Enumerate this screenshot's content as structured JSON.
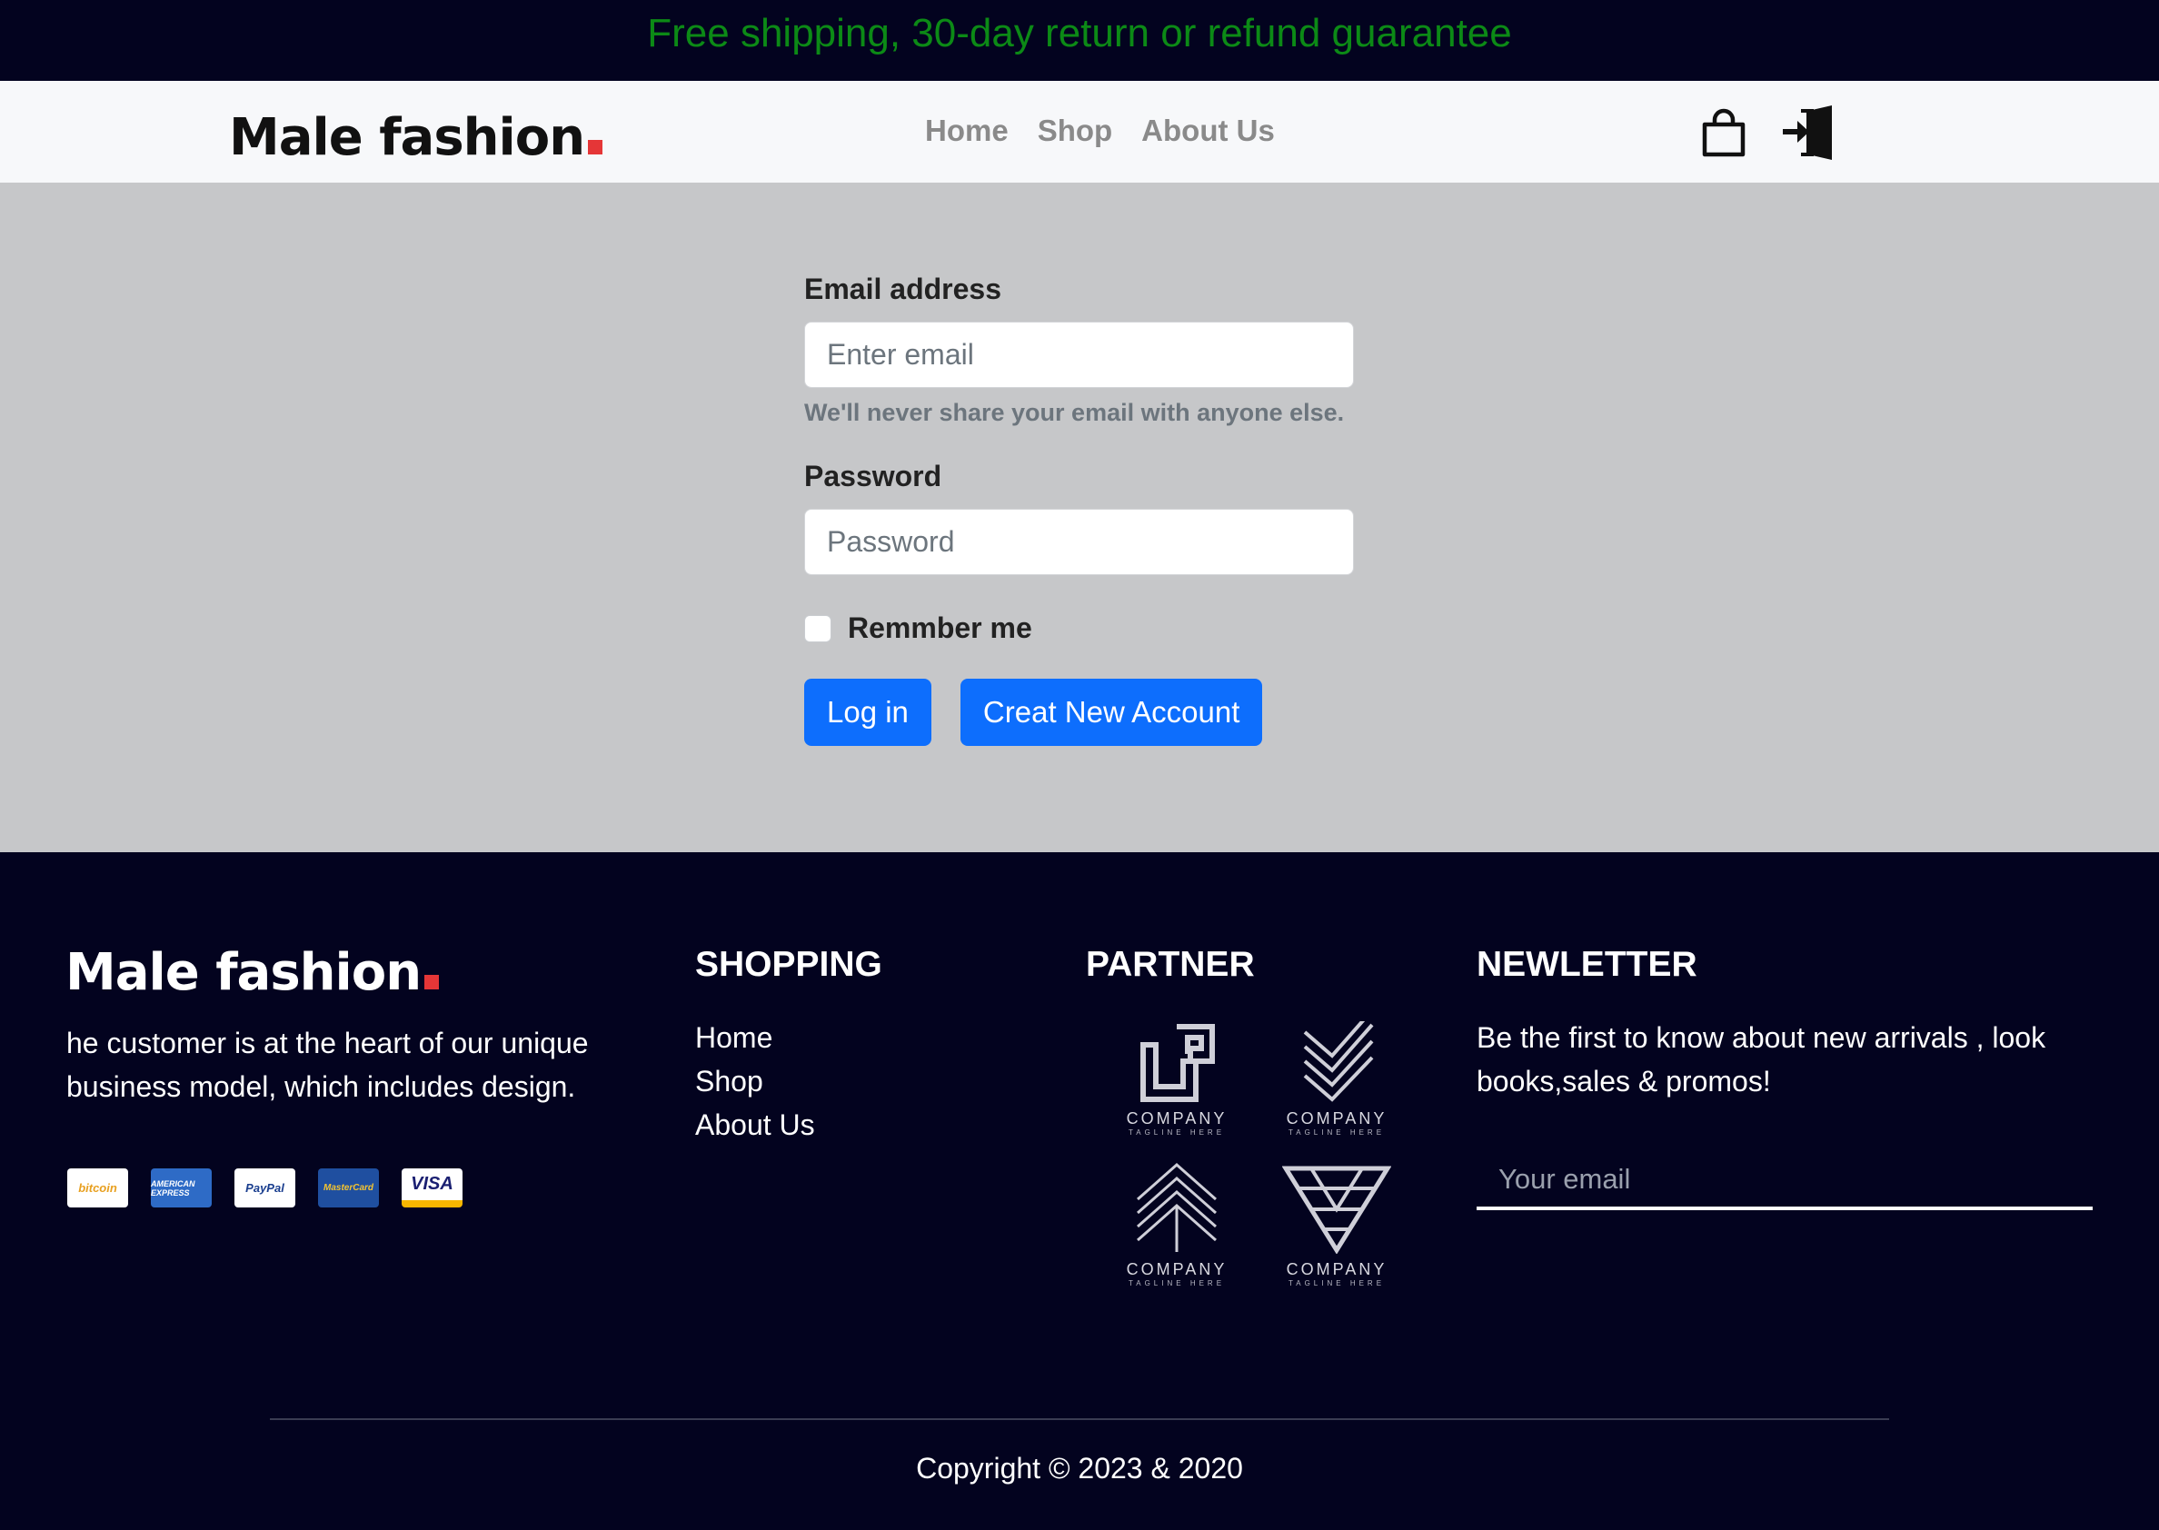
{
  "promo": {
    "text": "Free shipping, 30-day return or refund guarantee"
  },
  "brand": {
    "name": "Male fashion"
  },
  "nav": {
    "links": [
      "Home",
      "Shop",
      "About Us"
    ],
    "icons": [
      "shopping-bag-icon",
      "sign-in-icon"
    ]
  },
  "login": {
    "email_label": "Email address",
    "email_placeholder": "Enter email",
    "email_help": "We'll never share your email with anyone else.",
    "password_label": "Password",
    "password_placeholder": "Password",
    "remember_label": "Remmber me",
    "login_button": "Log in",
    "create_button": "Creat New Account"
  },
  "footer": {
    "about": "he customer is at the heart of our unique business model, which includes design.",
    "payments": [
      "bitcoin",
      "AMERICAN EXPRESS",
      "PayPal",
      "MasterCard",
      "VISA"
    ],
    "shopping_title": "SHOPPING",
    "shopping_links": [
      "Home",
      "Shop",
      "About Us"
    ],
    "partner_title": "PARTNER",
    "partners": [
      {
        "name": "COMPANY",
        "tagline": "TAGLINE HERE"
      },
      {
        "name": "COMPANY",
        "tagline": "TAGLINE HERE"
      },
      {
        "name": "COMPANY",
        "tagline": "TAGLINE HERE"
      },
      {
        "name": "COMPANY",
        "tagline": "TAGLINE HERE"
      }
    ],
    "newsletter_title": "NEWLETTER",
    "newsletter_text": "Be the first to know about new arrivals , look books,sales & promos!",
    "newsletter_placeholder": "Your email",
    "copyright": "Copyright © 2023 & 2020"
  },
  "colors": {
    "promo_text": "#0c8a16",
    "dark_bg": "#03031f",
    "primary": "#0d6efd",
    "accent": "#e53637",
    "page_bg": "#c6c7c9"
  }
}
